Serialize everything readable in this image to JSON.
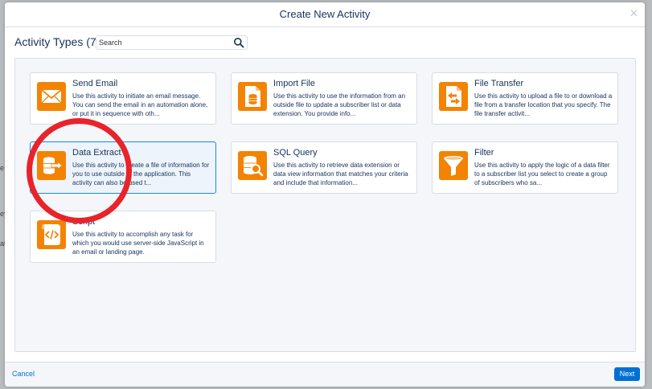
{
  "modal": {
    "title": "Create New Activity",
    "close_icon": "close-icon"
  },
  "toolbar": {
    "activity_types_label": "Activity Types (7)",
    "search_placeholder": "Search",
    "search_value": "",
    "search_icon": "search-icon"
  },
  "activities": [
    {
      "title": "Send Email",
      "icon": "envelope-icon",
      "selected": false,
      "description": "Use this activity to initiate an email message. You can send the email in an automation alone, or put it in sequence with oth..."
    },
    {
      "title": "Import File",
      "icon": "import-file-icon",
      "selected": false,
      "description": "Use this activity to use the information from an outside file to update a subscriber list or data extension. You provide info..."
    },
    {
      "title": "File Transfer",
      "icon": "file-transfer-icon",
      "selected": false,
      "description": "Use this activity to upload a file to or download a file from a transfer location that you specify. The file transfer activit..."
    },
    {
      "title": "Data Extract",
      "icon": "data-extract-icon",
      "selected": true,
      "description": "Use this activity to create a file of information for you to use outside of the application. This activity can also be used t..."
    },
    {
      "title": "SQL Query",
      "icon": "sql-query-icon",
      "selected": false,
      "description": "Use this activity to retrieve data extension or data view information that matches your criteria and include that information..."
    },
    {
      "title": "Filter",
      "icon": "funnel-icon",
      "selected": false,
      "description": "Use this activity to apply the logic of a data filter to a subscriber list you select to create a group of subscribers who sa..."
    },
    {
      "title": "Script",
      "icon": "script-icon",
      "selected": false,
      "description": "Use this activity to accomplish any task for which you would use server-side JavaScript in an email or landing page."
    }
  ],
  "footer": {
    "cancel_label": "Cancel",
    "next_label": "Next"
  },
  "colors": {
    "accent": "#f38303",
    "link": "#0070d2",
    "annotation_circle": "#e8232a"
  },
  "background_fragments": [
    "e",
    "ey",
    "ato"
  ]
}
